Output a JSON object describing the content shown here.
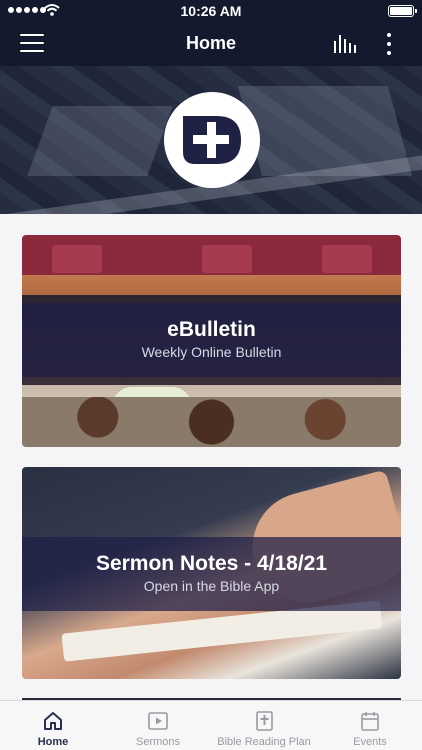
{
  "status_bar": {
    "time": "10:26 AM"
  },
  "nav": {
    "title": "Home"
  },
  "cards": [
    {
      "title": "eBulletin",
      "subtitle": "Weekly Online Bulletin"
    },
    {
      "title": "Sermon Notes - 4/18/21",
      "subtitle": "Open in the Bible App"
    }
  ],
  "tabs": [
    {
      "label": "Home",
      "icon": "home-icon",
      "active": true
    },
    {
      "label": "Sermons",
      "icon": "play-icon",
      "active": false
    },
    {
      "label": "Bible Reading Plan",
      "icon": "bible-icon",
      "active": false
    },
    {
      "label": "Events",
      "icon": "calendar-icon",
      "active": false
    }
  ],
  "colors": {
    "nav_bg": "#141a2e",
    "band": "#1e1e46",
    "active_tab": "#2a3150",
    "inactive_tab": "#9a9aa2"
  }
}
